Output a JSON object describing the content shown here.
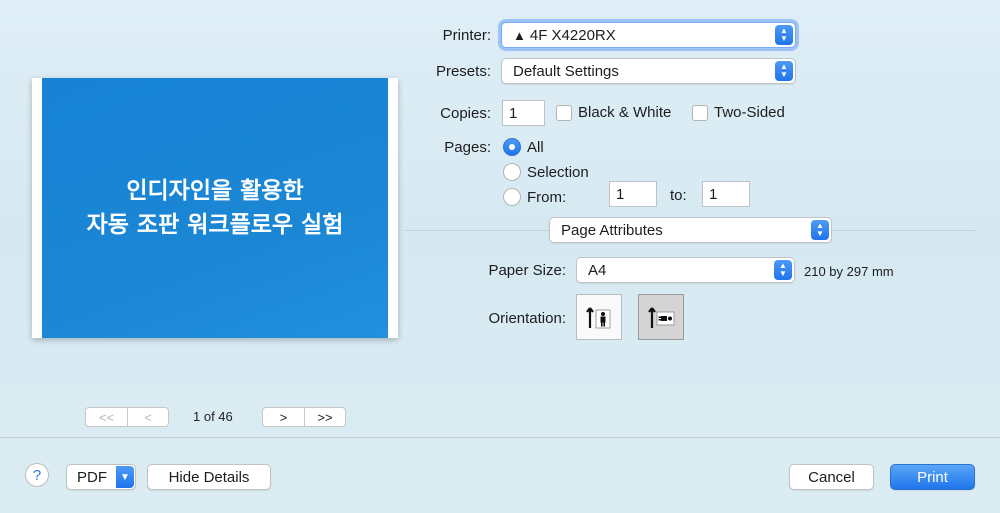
{
  "printer": {
    "label": "Printer:",
    "value": "4F X4220RX",
    "warning_icon": "warning-triangle-icon"
  },
  "presets": {
    "label": "Presets:",
    "value": "Default Settings"
  },
  "copies": {
    "label": "Copies:",
    "value": "1",
    "black_white": "Black & White",
    "two_sided": "Two-Sided"
  },
  "pages": {
    "label": "Pages:",
    "all": "All",
    "selection": "Selection",
    "from": "From:",
    "from_value": "1",
    "to": "to:",
    "to_value": "1"
  },
  "section": {
    "value": "Page Attributes"
  },
  "paper": {
    "label": "Paper Size:",
    "value": "A4",
    "dimensions": "210 by 297 mm"
  },
  "orientation": {
    "label": "Orientation:"
  },
  "preview": {
    "line1": "인디자인을 활용한",
    "line2": "자동 조판 워크플로우 실험",
    "page_count": "1 of 46",
    "first": "<<",
    "prev": "<",
    "next": ">",
    "last": ">>"
  },
  "footer": {
    "help": "?",
    "pdf": "PDF",
    "hide_details": "Hide Details",
    "cancel": "Cancel",
    "print": "Print"
  },
  "colors": {
    "accent": "#1f74ec",
    "slide_blue": "#1883d6"
  }
}
